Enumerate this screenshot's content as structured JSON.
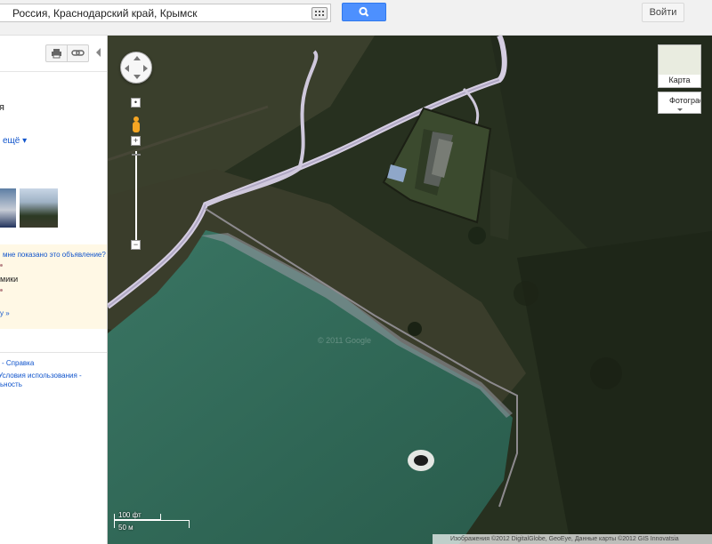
{
  "search": {
    "query": "Россия, Краснодарский край, Крымск"
  },
  "header": {
    "login_label": "Войти"
  },
  "sidebar": {
    "place_fragment": "я",
    "more_label": "ещё",
    "ad": {
      "why_label": "мне показано это объявление?",
      "text": "мики",
      "more_label": "у »"
    },
    "footer": {
      "help": "- Справка",
      "terms": "Условия использования -",
      "privacy": "ьность"
    }
  },
  "map": {
    "map_type_map": "Карта",
    "map_type_photo": "Фотограф",
    "scale_ft": "100 фт",
    "scale_m": "50 м",
    "attribution": "Изображения ©2012 DigitalGlobe, GeoEye, Данные карты ©2012 GIS Innovatsia",
    "watermark": "© 2011 Google"
  },
  "colors": {
    "search_button": "#4d90fe",
    "link": "#1155cc",
    "ad_background": "#fff8e5",
    "water": "#2f6354",
    "forest": "#262e1e"
  }
}
